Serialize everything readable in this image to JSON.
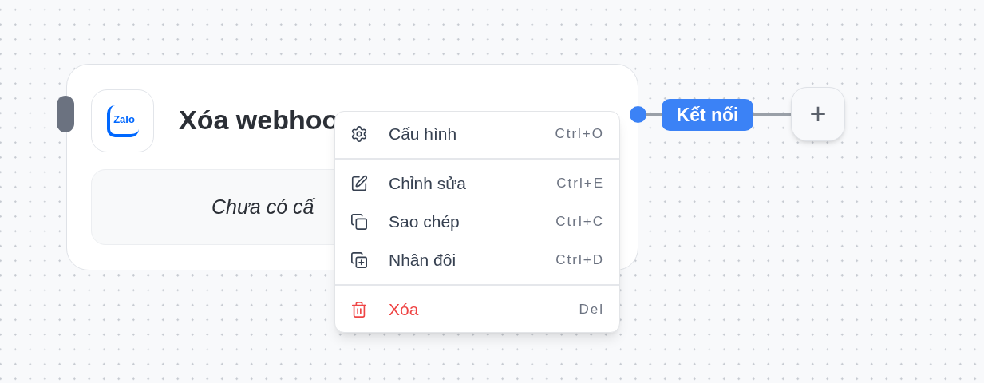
{
  "node": {
    "logo_text": "Zalo",
    "title": "Xóa webhoo",
    "placeholder": "Chưa có cấ"
  },
  "connector": {
    "label": "Kết nối",
    "add": "+"
  },
  "context_menu": [
    {
      "kind": "settings",
      "label": "Cấu hình",
      "shortcut": "Ctrl+O",
      "danger": false,
      "divider_after": true
    },
    {
      "kind": "edit",
      "label": "Chỉnh sửa",
      "shortcut": "Ctrl+E",
      "danger": false,
      "divider_after": false
    },
    {
      "kind": "copy",
      "label": "Sao chép",
      "shortcut": "Ctrl+C",
      "danger": false,
      "divider_after": false
    },
    {
      "kind": "duplicate",
      "label": "Nhân đôi",
      "shortcut": "Ctrl+D",
      "danger": false,
      "divider_after": true
    },
    {
      "kind": "delete",
      "label": "Xóa",
      "shortcut": "Del",
      "danger": true,
      "divider_after": false
    }
  ]
}
